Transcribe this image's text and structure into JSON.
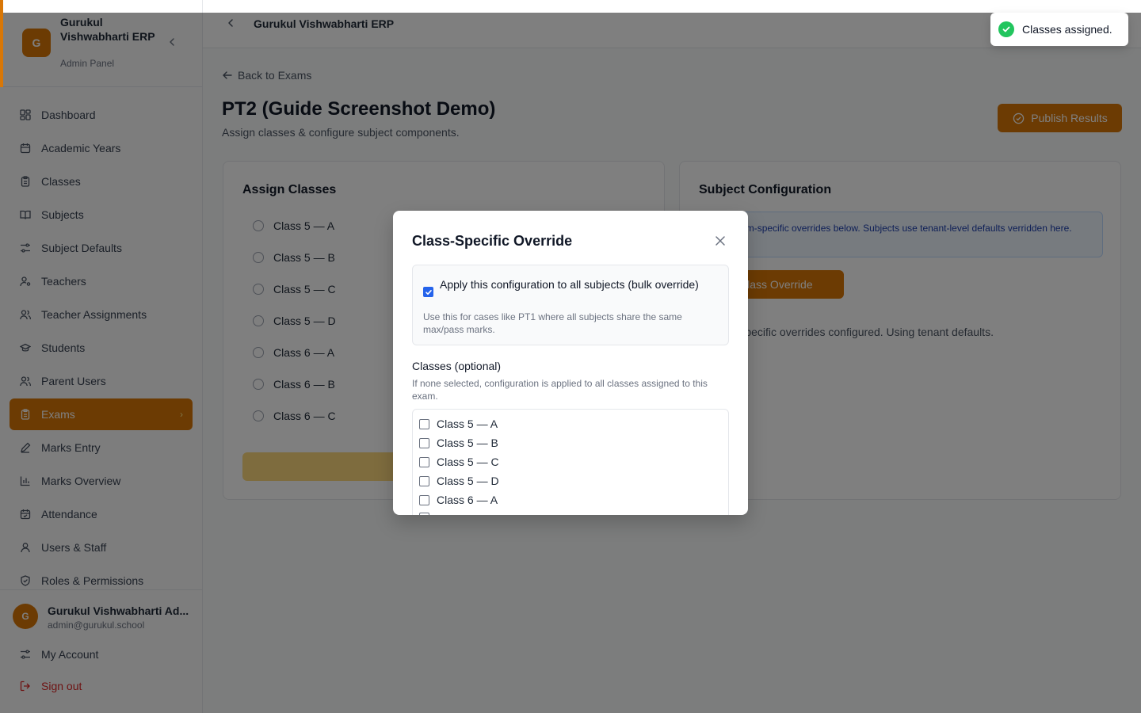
{
  "app": {
    "brand_initial": "G",
    "brand_name": "Gurukul Vishwabharti ERP",
    "brand_sub": "Admin Panel",
    "accent": "#d97706"
  },
  "sidebar": {
    "items": [
      {
        "label": "Dashboard",
        "icon": "dashboard-icon"
      },
      {
        "label": "Academic Years",
        "icon": "calendar-icon"
      },
      {
        "label": "Classes",
        "icon": "clipboard-icon"
      },
      {
        "label": "Subjects",
        "icon": "book-icon"
      },
      {
        "label": "Subject Defaults",
        "icon": "sliders-icon"
      },
      {
        "label": "Teachers",
        "icon": "user-cog-icon"
      },
      {
        "label": "Teacher Assignments",
        "icon": "users-icon"
      },
      {
        "label": "Students",
        "icon": "graduation-cap-icon"
      },
      {
        "label": "Parent Users",
        "icon": "users-icon"
      },
      {
        "label": "Exams",
        "icon": "clipboard-icon",
        "active": true
      },
      {
        "label": "Marks Entry",
        "icon": "pencil-icon"
      },
      {
        "label": "Marks Overview",
        "icon": "bar-chart-icon"
      },
      {
        "label": "Attendance",
        "icon": "calendar-check-icon"
      },
      {
        "label": "Users & Staff",
        "icon": "user-icon"
      },
      {
        "label": "Roles & Permissions",
        "icon": "shield-icon"
      }
    ],
    "user": {
      "initial": "G",
      "name": "Gurukul Vishwabharti Ad...",
      "email": "admin@gurukul.school"
    },
    "my_account": "My Account",
    "sign_out": "Sign out"
  },
  "topbar": {
    "title": "Gurukul Vishwabharti ERP"
  },
  "page": {
    "back_label": "Back to Exams",
    "title": "PT2 (Guide Screenshot Demo)",
    "subtitle": "Assign classes & configure subject components.",
    "publish_label": "Publish Results"
  },
  "assign": {
    "title": "Assign Classes",
    "classes": [
      "Class 5 — A",
      "Class 5 — B",
      "Class 5 — C",
      "Class 5 — D",
      "Class 6 — A",
      "Class 6 — B",
      "Class 6 — C"
    ]
  },
  "subject_config": {
    "title": "Subject Configuration",
    "info_visible": "gure exam-specific overrides below. Subjects use tenant-level defaults verridden here.",
    "add_override_label": "d Class Override",
    "no_override": "lo class-specific overrides configured. Using tenant defaults."
  },
  "modal": {
    "title": "Class-Specific Override",
    "bulk_label": "Apply this configuration to all subjects (bulk override)",
    "bulk_checked": true,
    "bulk_help": "Use this for cases like PT1 where all subjects share the same max/pass marks.",
    "classes_label": "Classes (optional)",
    "classes_help": "If none selected, configuration is applied to all classes assigned to this exam.",
    "class_options": [
      "Class 5 — A",
      "Class 5 — B",
      "Class 5 — C",
      "Class 5 — D",
      "Class 6 — A"
    ]
  },
  "toast": {
    "message": "Classes assigned.",
    "color": "#22c55e"
  }
}
